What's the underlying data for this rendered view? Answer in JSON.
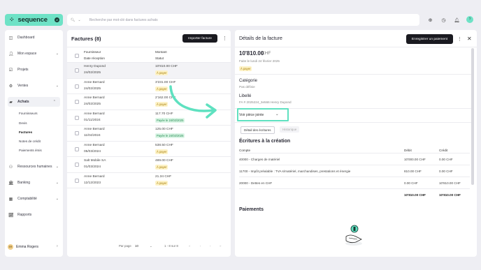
{
  "brand": {
    "name": "sequence",
    "badge": "Ø"
  },
  "search": {
    "placeholder": "Recherche par mot-clé dans factures achats"
  },
  "sidebar": {
    "items": [
      {
        "label": "Dashboard",
        "icon": "dashboard-icon"
      },
      {
        "label": "Mon espace",
        "icon": "person-icon"
      },
      {
        "label": "Projets",
        "icon": "check-square-icon"
      },
      {
        "label": "Ventes",
        "icon": "sales-icon"
      },
      {
        "label": "Achats",
        "icon": "bag-icon"
      },
      {
        "label": "Ressources humaines",
        "icon": "people-icon"
      },
      {
        "label": "Banking",
        "icon": "bank-icon"
      },
      {
        "label": "Comptabilité",
        "icon": "calculator-icon"
      },
      {
        "label": "Rapports",
        "icon": "chart-icon"
      }
    ],
    "subitems": [
      "Fournisseurs",
      "Devis",
      "Factures",
      "Notes de crédit",
      "Paiements émis"
    ],
    "user": {
      "initials": "ER",
      "name": "Emma Rogers"
    }
  },
  "list": {
    "title": "Factures (8)",
    "import_label": "Importer facture",
    "headers": {
      "supplier": "Fournisseur",
      "date": "Date réception",
      "amount": "Montant",
      "status": "Statut"
    },
    "rows": [
      {
        "supplier": "Henry Dupond",
        "date": "24/02/2025",
        "amount": "10'810.00 CHF",
        "status": "À payer",
        "tone": "y"
      },
      {
        "supplier": "Anne Bernard",
        "date": "24/02/2025",
        "amount": "3'231.00 CHF",
        "status": "À payer",
        "tone": "y"
      },
      {
        "supplier": "Anne Bernard",
        "date": "24/02/2025",
        "amount": "2'162.00 CHF",
        "status": "À payer",
        "tone": "y"
      },
      {
        "supplier": "Anne Bernard",
        "date": "01/11/2024",
        "amount": "117.70 CHF",
        "status": "Payée le 24/02/2025",
        "tone": "g"
      },
      {
        "supplier": "Anne Bernard",
        "date": "11/04/2024",
        "amount": "125.00 CHF",
        "status": "Payée le 24/02/2025",
        "tone": "g"
      },
      {
        "supplier": "Anne Bernard",
        "date": "05/03/2024",
        "amount": "538.50 CHF",
        "status": "À payer",
        "tone": "y"
      },
      {
        "supplier": "Salt Mobile SA",
        "date": "01/03/2024",
        "amount": "489.00 CHF",
        "status": "À payer",
        "tone": "y"
      },
      {
        "supplier": "Anne Bernard",
        "date": "12/12/2023",
        "amount": "21.34 CHF",
        "status": "À payer",
        "tone": "y"
      }
    ],
    "pagination": {
      "per_page_label": "Par page",
      "per_page": "10",
      "range": "1 - 8 sur 8"
    }
  },
  "detail": {
    "title": "Détails de la facture",
    "save_label": "Enregistrer un paiement",
    "amount": "10'810.00",
    "currency": "CHF",
    "date_text": "Faite le lundi 24 février 2025",
    "status": "À payer",
    "category_label": "Catégorie",
    "category_value": "Pas définie",
    "libelle_label": "Libellé",
    "libelle_value": "FA # 2025224_3e566 Henry Dupond",
    "attachment_label": "Voir pièce jointe",
    "tabs": [
      "Détail des écritures",
      "Historique"
    ],
    "entries_title": "Écritures à la création",
    "entries_headers": {
      "account": "Compte",
      "debit": "Débit",
      "credit": "Crédit"
    },
    "entries": [
      {
        "account": "40000 - Charges de matériel",
        "debit": "10'000.00 CHF",
        "credit": "0.00 CHF"
      },
      {
        "account": "11700 - Impôt préalable : TVA s/matériel, marchandises, prestations et énergie",
        "debit": "810.00 CHF",
        "credit": "0.00 CHF"
      },
      {
        "account": "20000 - Dettes en CHF",
        "debit": "0.00 CHF",
        "credit": "10'810.00 CHF"
      }
    ],
    "totals": {
      "debit": "10'810.00 CHF",
      "credit": "10'810.00 CHF"
    },
    "payments_title": "Paiements"
  },
  "colors": {
    "accent": "#6ee2c6",
    "highlight": "#5fe1c0",
    "dark": "#1a1a20"
  }
}
